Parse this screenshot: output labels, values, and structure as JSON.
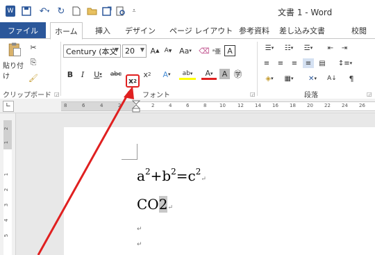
{
  "window": {
    "title": "文書 1 - Word"
  },
  "tabs": [
    "ファイル",
    "ホーム",
    "挿入",
    "デザイン",
    "ページ レイアウト",
    "参考資料",
    "差し込み文書",
    "校閲"
  ],
  "ribbon": {
    "clipboard": {
      "paste_label": "貼り付け",
      "group_label": "クリップボード"
    },
    "font": {
      "font_name": "Century (本文",
      "font_size": "20",
      "group_label": "フォント"
    },
    "paragraph": {
      "group_label": "段落"
    }
  },
  "ruler": {
    "numbers": [
      "8",
      "6",
      "4",
      "2",
      "2",
      "4",
      "6",
      "8",
      "10",
      "12",
      "14",
      "16",
      "18",
      "20",
      "22",
      "24",
      "26"
    ],
    "vertical_numbers": [
      "2",
      "1",
      "1",
      "2",
      "3",
      "4",
      "5"
    ]
  },
  "document": {
    "line1": {
      "a": "a",
      "b": "+b",
      "c": "=c",
      "exp": "2"
    },
    "line2": {
      "text": "CO",
      "highlight": "2"
    },
    "para_mark": "↵"
  },
  "annotation": {
    "color": "#e02020"
  }
}
